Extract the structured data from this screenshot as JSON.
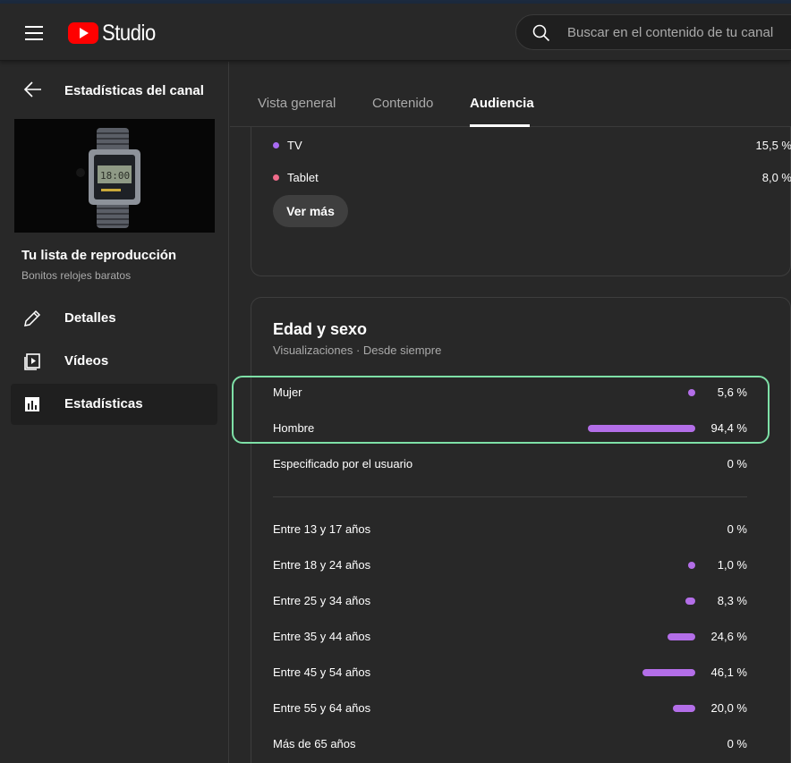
{
  "header": {
    "logo_text": "Studio",
    "search_placeholder": "Buscar en el contenido de tu canal"
  },
  "sidebar": {
    "back_title": "Estadísticas del canal",
    "playlist_title": "Tu lista de reproducción",
    "playlist_subtitle": "Bonitos relojes baratos",
    "items": [
      {
        "label": "Detalles",
        "icon": "pencil-icon"
      },
      {
        "label": "Vídeos",
        "icon": "video-icon"
      },
      {
        "label": "Estadísticas",
        "icon": "analytics-icon"
      }
    ]
  },
  "tabs": [
    {
      "label": "Vista general"
    },
    {
      "label": "Contenido"
    },
    {
      "label": "Audiencia"
    }
  ],
  "devices_card": {
    "rows": [
      {
        "label": "TV",
        "value": "15,5 %",
        "color": "#a96bf2"
      },
      {
        "label": "Tablet",
        "value": "8,0 %",
        "color": "#ef6b8a"
      }
    ],
    "button_label": "Ver más"
  },
  "age_gender_card": {
    "title": "Edad y sexo",
    "subtitle": "Visualizaciones · Desde siempre",
    "gender": [
      {
        "label": "Mujer",
        "value": "5,6 %",
        "fraction": 0.056
      },
      {
        "label": "Hombre",
        "value": "94,4 %",
        "fraction": 0.944
      },
      {
        "label": "Especificado por el usuario",
        "value": "0 %",
        "fraction": 0
      }
    ],
    "age": [
      {
        "label": "Entre 13 y 17 años",
        "value": "0 %",
        "fraction": 0
      },
      {
        "label": "Entre 18 y 24 años",
        "value": "1,0 %",
        "fraction": 0.01
      },
      {
        "label": "Entre 25 y 34 años",
        "value": "8,3 %",
        "fraction": 0.083
      },
      {
        "label": "Entre 35 y 44 años",
        "value": "24,6 %",
        "fraction": 0.246
      },
      {
        "label": "Entre 45 y 54 años",
        "value": "46,1 %",
        "fraction": 0.461
      },
      {
        "label": "Entre 55 y 64 años",
        "value": "20,0 %",
        "fraction": 0.2
      },
      {
        "label": "Más de 65 años",
        "value": "0 %",
        "fraction": 0
      }
    ],
    "bar_color": "#b36ee8"
  }
}
